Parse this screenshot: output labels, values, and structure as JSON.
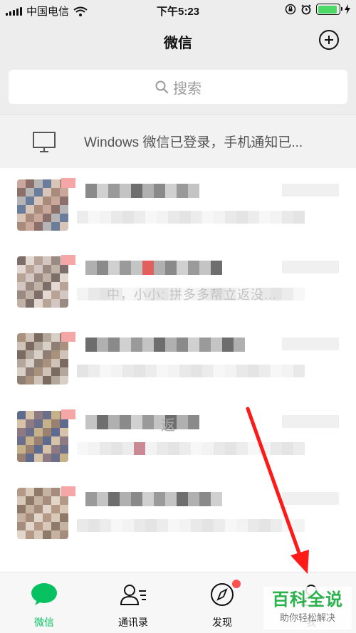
{
  "status_bar": {
    "carrier": "中国电信",
    "time": "下午5:23",
    "battery_percent": 90
  },
  "nav": {
    "title": "微信"
  },
  "search": {
    "placeholder": "搜索"
  },
  "windows_banner": {
    "text": "Windows 微信已登录，手机通知已..."
  },
  "chats": [
    {
      "message_visible": ""
    },
    {
      "message_visible": "中，小小: 拼多多帮立返没..."
    },
    {
      "message_visible": ""
    },
    {
      "name_visible": "返",
      "message_visible": ""
    },
    {
      "message_visible": ""
    }
  ],
  "tabs": [
    {
      "label": "微信",
      "active": true,
      "icon": "chat-bubble-icon"
    },
    {
      "label": "通讯录",
      "active": false,
      "icon": "contacts-icon"
    },
    {
      "label": "发现",
      "active": false,
      "icon": "compass-icon"
    },
    {
      "label": "我",
      "active": false,
      "icon": "person-icon"
    }
  ],
  "watermark": {
    "main": "百科全说",
    "sub": "助你轻松解决"
  },
  "colors": {
    "accent": "#07c160",
    "badge": "#fa5151",
    "arrow": "#ff1a1a"
  }
}
